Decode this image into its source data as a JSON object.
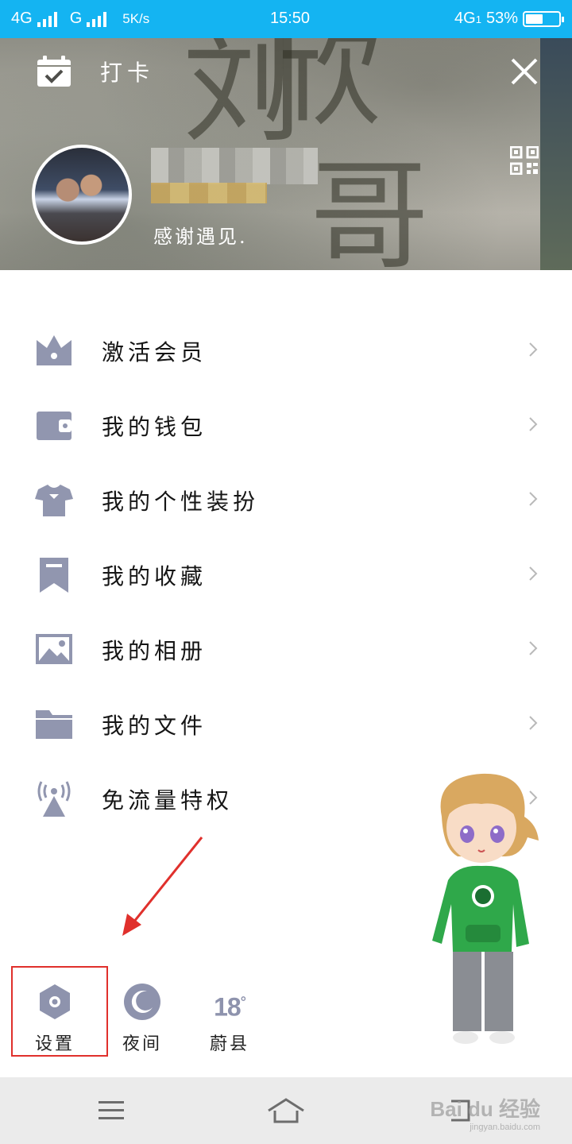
{
  "status_bar": {
    "network1": "4G",
    "network2": "G",
    "speed": "5K/s",
    "time": "15:50",
    "network_right": "4G",
    "sim_slot": "1",
    "battery_text": "53%",
    "battery_level": 0.53,
    "background_color": "#14b4f2"
  },
  "header": {
    "checkin_label": "打卡",
    "signature": "感谢遇见.",
    "carving_chars": [
      "刘",
      "欣",
      "哥"
    ],
    "icons": [
      "calendar-check-icon",
      "close-icon",
      "qr-code-icon"
    ]
  },
  "menu": [
    {
      "label": "激活会员",
      "icon": "crown-icon"
    },
    {
      "label": "我的钱包",
      "icon": "wallet-icon"
    },
    {
      "label": "我的个性装扮",
      "icon": "tshirt-icon"
    },
    {
      "label": "我的收藏",
      "icon": "bookmark-icon"
    },
    {
      "label": "我的相册",
      "icon": "photo-icon"
    },
    {
      "label": "我的文件",
      "icon": "folder-icon"
    },
    {
      "label": "免流量特权",
      "icon": "broadcast-tower-icon"
    }
  ],
  "actions": {
    "settings_label": "设置",
    "night_label": "夜间",
    "weather_temp": "18",
    "weather_unit": "°",
    "weather_location": "蔚县"
  },
  "nav": {
    "icons": [
      "menu-icon",
      "home-icon",
      "back-icon"
    ]
  },
  "watermark": {
    "brand": "Bai du 经验",
    "url": "jingyan.baidu.com"
  },
  "colors": {
    "icon_gray": "#9196af",
    "highlight_red": "#e0302c",
    "arrow_red": "#e0302c",
    "nav_bg": "#ebebeb"
  }
}
